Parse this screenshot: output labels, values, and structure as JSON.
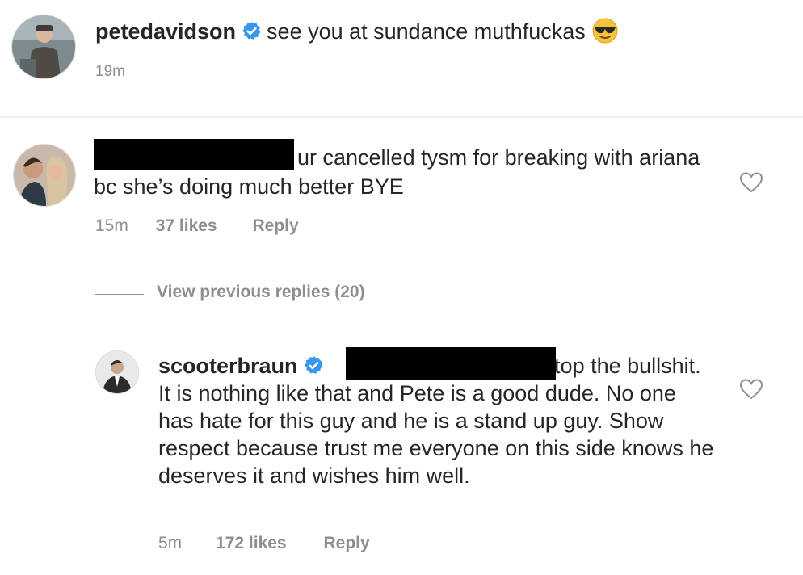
{
  "post": {
    "username": "petedavidson",
    "caption": "see you at sundance muthfuckas",
    "emoji": "smiling-face-with-sunglasses",
    "time": "19m"
  },
  "comment1": {
    "text": "ur cancelled tysm for breaking with ariana bc she’s doing much better BYE",
    "time": "15m",
    "likes": "37 likes",
    "reply_label": "Reply"
  },
  "view_replies": {
    "label": "View previous replies (20)"
  },
  "comment2": {
    "username": "scooterbraun",
    "text": "stop the bullshit. It is nothing like that and Pete is a good dude. No one has hate for this guy and he is a stand up guy. Show respect because trust me everyone on this side knows he deserves it and wishes him well.",
    "time": "5m",
    "likes": "172 likes",
    "reply_label": "Reply"
  },
  "colors": {
    "text": "#262626",
    "secondary": "#8e8e8e",
    "verified": "#3897f0",
    "divider": "#efefef",
    "redaction": "#000000"
  },
  "icons": [
    "verified-badge-icon",
    "heart-outline-icon",
    "sunglasses-emoji-icon"
  ]
}
